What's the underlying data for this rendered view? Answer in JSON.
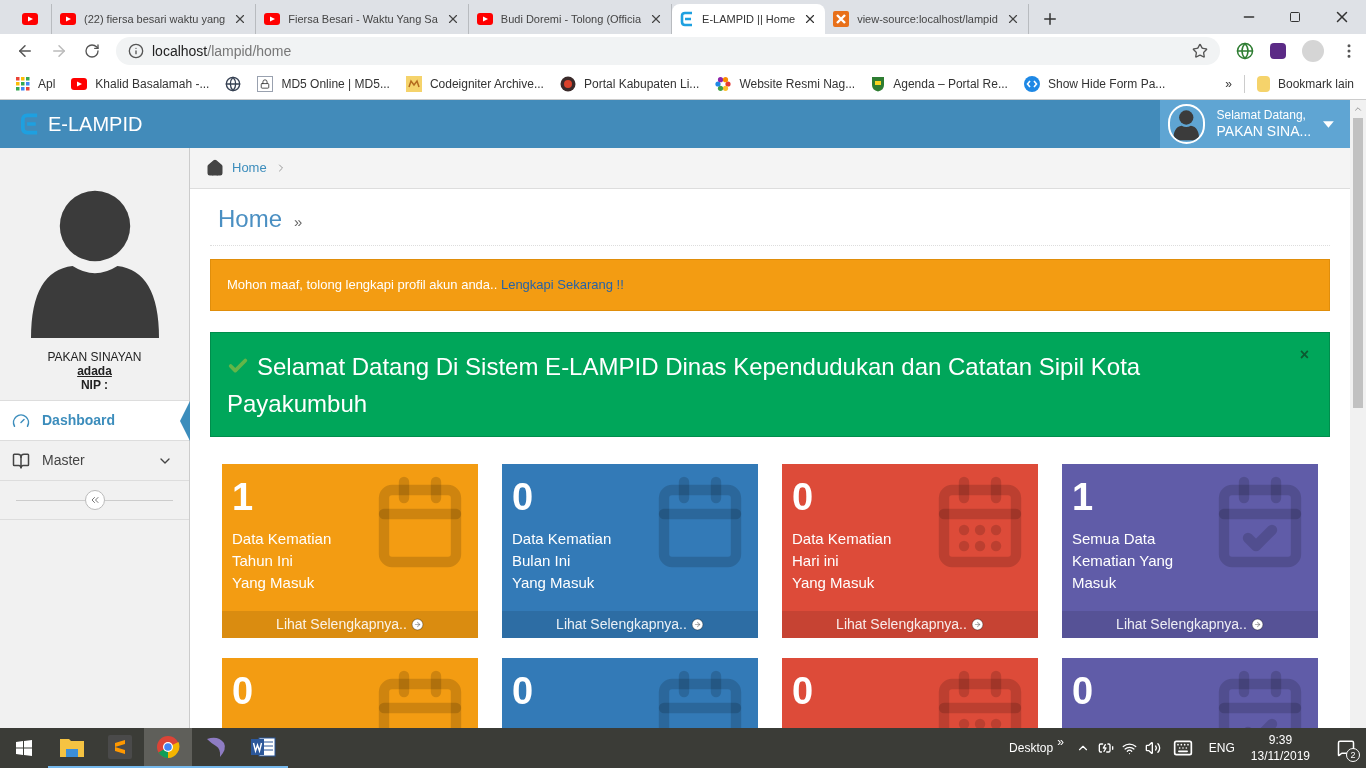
{
  "browser": {
    "tabs": [
      {
        "kind": "youtube",
        "selected": false
      },
      {
        "kind": "youtube",
        "title": "(22) fiersa besari waktu yang",
        "selected": false
      },
      {
        "kind": "youtube",
        "title": "Fiersa Besari - Waktu Yang Sa",
        "selected": false
      },
      {
        "kind": "youtube",
        "title": "Budi Doremi - Tolong (Officia",
        "selected": false
      },
      {
        "kind": "elampid",
        "title": "E-LAMPID || Home",
        "selected": true
      },
      {
        "kind": "xampp",
        "title": "view-source:localhost/lampid",
        "selected": false
      }
    ],
    "url_host": "localhost",
    "url_path": "/lampid/home",
    "bookmarks": [
      {
        "kind": "apps",
        "label": "Apl"
      },
      {
        "kind": "youtube",
        "label": "Khalid Basalamah -..."
      },
      {
        "kind": "globe"
      },
      {
        "kind": "lock",
        "label": "MD5 Online | MD5..."
      },
      {
        "kind": "mylo",
        "label": "Codeigniter Archive..."
      },
      {
        "kind": "portal",
        "label": "Portal Kabupaten Li..."
      },
      {
        "kind": "flower",
        "label": "Website Resmi Nag..."
      },
      {
        "kind": "shield",
        "label": "Agenda – Portal Re..."
      },
      {
        "kind": "swap",
        "label": "Show Hide Form Pa..."
      }
    ],
    "more_bookmarks": "»",
    "other_bookmarks": "Bookmark lain"
  },
  "app": {
    "brand": "E-LAMPID",
    "user_greeting": "Selamat Datang,",
    "user_name": "PAKAN SINA..."
  },
  "sidebar": {
    "name": "PAKAN SINAYAN",
    "username": "adada",
    "nip": "NIP :",
    "items": [
      {
        "kind": "dashboard",
        "label": "Dashboard",
        "selected": true,
        "expandable": false
      },
      {
        "kind": "book",
        "label": "Master",
        "selected": false,
        "expandable": true
      }
    ]
  },
  "breadcrumb": [
    "Home"
  ],
  "page_title": "Home",
  "page_title_mark": "»",
  "warning": {
    "text": "Mohon maaf, tolong lengkapi profil akun anda..",
    "link": "Lengkapi Sekarang !!"
  },
  "welcome": {
    "text": "Selamat Datang Di Sistem E-LAMPID Dinas Kependudukan dan Catatan Sipil Kota Payakumbuh",
    "close": "×"
  },
  "cards": [
    {
      "value": "1",
      "lines": [
        "Data Kematian",
        "Tahun Ini",
        "Yang Masuk"
      ],
      "kind": "blank",
      "color": "#f39c12",
      "footer": "Lihat Selengkapnya.."
    },
    {
      "value": "0",
      "lines": [
        "Data Kematian",
        "Bulan Ini",
        "Yang Masuk"
      ],
      "kind": "blank",
      "color": "#337ab7",
      "footer": "Lihat Selengkapnya.."
    },
    {
      "value": "0",
      "lines": [
        "Data Kematian",
        "Hari ini",
        "Yang Masuk"
      ],
      "kind": "grid",
      "color": "#dd4b39",
      "footer": "Lihat Selengkapnya.."
    },
    {
      "value": "1",
      "lines": [
        "Semua Data",
        "Kematian Yang",
        "Masuk"
      ],
      "kind": "check",
      "color": "#605ca8",
      "footer": "Lihat Selengkapnya.."
    },
    {
      "value": "0",
      "kind": "blank",
      "color": "#f39c12"
    },
    {
      "value": "0",
      "kind": "blank",
      "color": "#337ab7"
    },
    {
      "value": "0",
      "kind": "grid",
      "color": "#dd4b39"
    },
    {
      "value": "0",
      "kind": "check",
      "color": "#605ca8"
    }
  ],
  "taskbar": {
    "apps": [
      {
        "kind": "folder",
        "selected": false
      },
      {
        "kind": "sublime",
        "selected": false
      },
      {
        "kind": "chrome",
        "selected": true
      },
      {
        "kind": "dolphin",
        "selected": false
      },
      {
        "kind": "word",
        "selected": false
      }
    ],
    "desktop": "Desktop",
    "more": "»",
    "language": "ENG",
    "time": "9:39",
    "date": "13/11/2019",
    "notifications": "2"
  }
}
